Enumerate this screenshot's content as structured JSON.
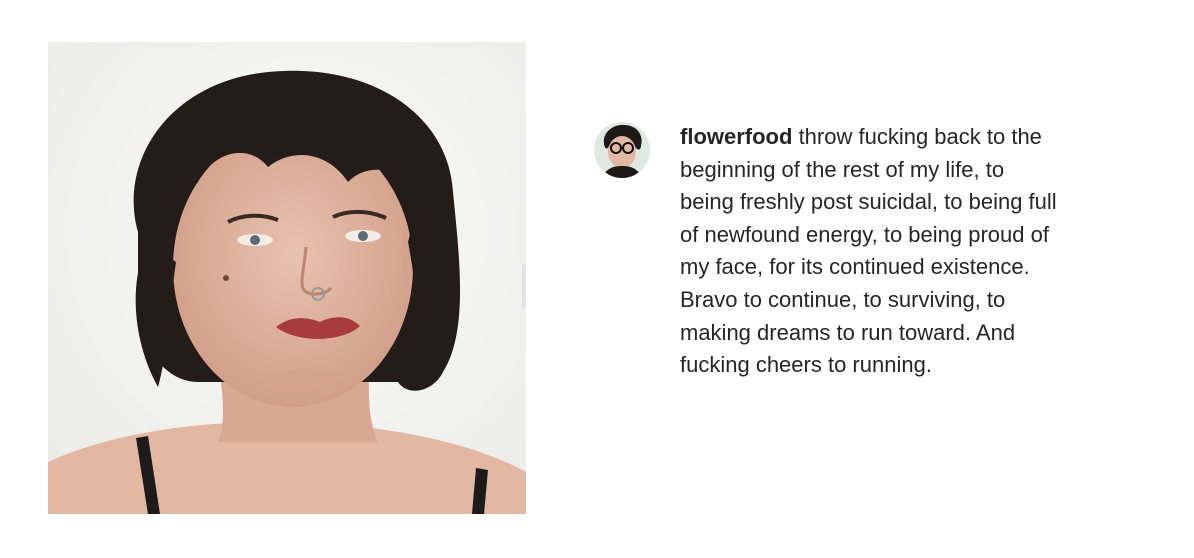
{
  "post": {
    "image_alt": "Selfie of a person with short dark wavy hair, a nose ring and red lipstick against a white wall",
    "caption": {
      "username": "flowerfood",
      "lines": [
        "throw fucking back to the",
        "beginning of the rest of my life, to",
        "being freshly post suicidal, to being full",
        "of newfound energy, to being proud of",
        "my face, for its continued existence.",
        "Bravo to continue, to surviving, to",
        "making dreams to run toward. And",
        "fucking cheers to running."
      ]
    }
  },
  "colors": {
    "text": "#262626",
    "background": "#ffffff"
  }
}
